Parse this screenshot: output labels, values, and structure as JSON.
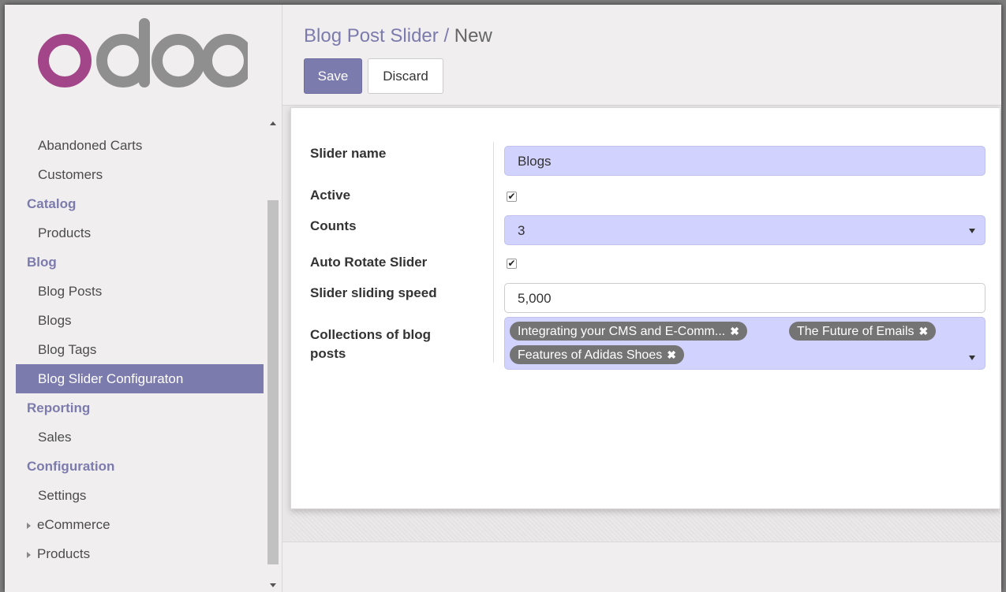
{
  "logo": {
    "text": "odoo",
    "accent": "#a24689",
    "grey": "#8f8f8f"
  },
  "sidebar": {
    "items": [
      {
        "type": "item",
        "label": "Abandoned Carts"
      },
      {
        "type": "item",
        "label": "Customers"
      },
      {
        "type": "header",
        "label": "Catalog"
      },
      {
        "type": "item",
        "label": "Products"
      },
      {
        "type": "header",
        "label": "Blog"
      },
      {
        "type": "item",
        "label": "Blog Posts"
      },
      {
        "type": "item",
        "label": "Blogs"
      },
      {
        "type": "item",
        "label": "Blog Tags"
      },
      {
        "type": "item",
        "label": "Blog Slider Configuraton",
        "active": true
      },
      {
        "type": "header",
        "label": "Reporting"
      },
      {
        "type": "item",
        "label": "Sales"
      },
      {
        "type": "header",
        "label": "Configuration"
      },
      {
        "type": "item",
        "label": "Settings"
      },
      {
        "type": "caret",
        "label": "eCommerce"
      },
      {
        "type": "caret",
        "label": "Products"
      }
    ]
  },
  "header": {
    "breadcrumb_parent": "Blog Post Slider",
    "breadcrumb_sep": "/",
    "breadcrumb_current": "New",
    "save_label": "Save",
    "discard_label": "Discard"
  },
  "form": {
    "slider_name_label": "Slider name",
    "slider_name_value": "Blogs",
    "active_label": "Active",
    "active_checked": true,
    "counts_label": "Counts",
    "counts_value": "3",
    "auto_rotate_label": "Auto Rotate Slider",
    "auto_rotate_checked": true,
    "speed_label": "Slider sliding speed",
    "speed_value": "5,000",
    "collections_label_line1": "Collections of blog",
    "collections_label_line2": "posts",
    "tags": [
      "Integrating your CMS and E-Comm...",
      "The Future of Emails",
      "Features of Adidas Shoes"
    ],
    "tag_remove_glyph": "✖",
    "check_glyph": "✔"
  },
  "colors": {
    "brand": "#7c7bad",
    "required_field": "#d2d2ff",
    "tag": "#747474"
  }
}
